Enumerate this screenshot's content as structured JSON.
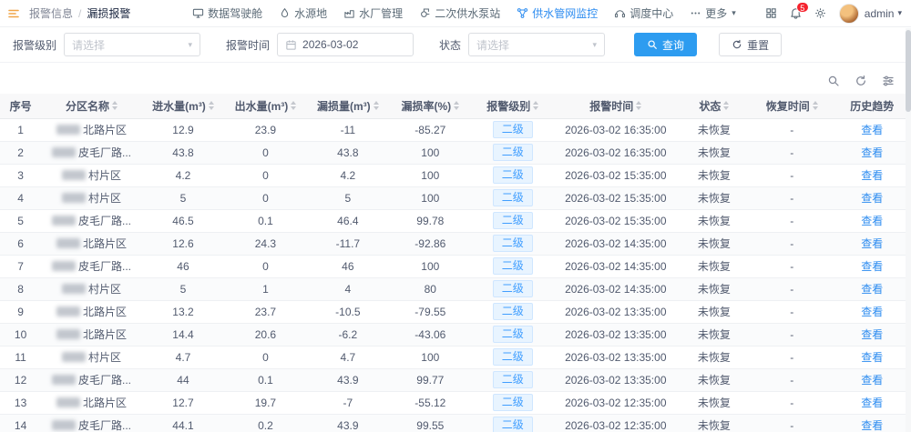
{
  "topbar": {
    "breadcrumb": {
      "parent": "报警信息",
      "separator": "/",
      "current": "漏损报警"
    },
    "nav": [
      {
        "label": "数据驾驶舱",
        "icon": "dashboard",
        "active": false
      },
      {
        "label": "水源地",
        "icon": "water-source",
        "active": false
      },
      {
        "label": "水厂管理",
        "icon": "water-plant",
        "active": false
      },
      {
        "label": "二次供水泵站",
        "icon": "pump-station",
        "active": false
      },
      {
        "label": "供水管网监控",
        "icon": "pipe-network",
        "active": true
      },
      {
        "label": "调度中心",
        "icon": "dispatch-center",
        "active": false
      },
      {
        "label": "更多",
        "icon": "more",
        "active": false,
        "caret": true
      }
    ],
    "badge_count": "5",
    "username": "admin"
  },
  "filters": {
    "level_label": "报警级别",
    "level_placeholder": "请选择",
    "time_label": "报警时间",
    "time_value": "2026-03-02",
    "status_label": "状态",
    "status_placeholder": "请选择",
    "search_label": "查询",
    "reset_label": "重置"
  },
  "table": {
    "headers": [
      "序号",
      "分区名称",
      "进水量(m³)",
      "出水量(m³)",
      "漏损量(m³)",
      "漏损率(%)",
      "报警级别",
      "报警时间",
      "状态",
      "恢复时间",
      "历史趋势"
    ],
    "rows": [
      {
        "index": "1",
        "zone": "北路片区",
        "in": "12.9",
        "out": "23.9",
        "loss": "-11",
        "rate": "-85.27",
        "level": "二级",
        "time": "2026-03-02 16:35:00",
        "status": "未恢复",
        "recover": "-",
        "action": "查看"
      },
      {
        "index": "2",
        "zone": "皮毛厂路...",
        "in": "43.8",
        "out": "0",
        "loss": "43.8",
        "rate": "100",
        "level": "二级",
        "time": "2026-03-02 16:35:00",
        "status": "未恢复",
        "recover": "-",
        "action": "查看"
      },
      {
        "index": "3",
        "zone": "村片区",
        "in": "4.2",
        "out": "0",
        "loss": "4.2",
        "rate": "100",
        "level": "二级",
        "time": "2026-03-02 15:35:00",
        "status": "未恢复",
        "recover": "-",
        "action": "查看"
      },
      {
        "index": "4",
        "zone": "村片区",
        "in": "5",
        "out": "0",
        "loss": "5",
        "rate": "100",
        "level": "二级",
        "time": "2026-03-02 15:35:00",
        "status": "未恢复",
        "recover": "-",
        "action": "查看"
      },
      {
        "index": "5",
        "zone": "皮毛厂路...",
        "in": "46.5",
        "out": "0.1",
        "loss": "46.4",
        "rate": "99.78",
        "level": "二级",
        "time": "2026-03-02 15:35:00",
        "status": "未恢复",
        "recover": "-",
        "action": "查看"
      },
      {
        "index": "6",
        "zone": "北路片区",
        "in": "12.6",
        "out": "24.3",
        "loss": "-11.7",
        "rate": "-92.86",
        "level": "二级",
        "time": "2026-03-02 14:35:00",
        "status": "未恢复",
        "recover": "-",
        "action": "查看"
      },
      {
        "index": "7",
        "zone": "皮毛厂路...",
        "in": "46",
        "out": "0",
        "loss": "46",
        "rate": "100",
        "level": "二级",
        "time": "2026-03-02 14:35:00",
        "status": "未恢复",
        "recover": "-",
        "action": "查看"
      },
      {
        "index": "8",
        "zone": "村片区",
        "in": "5",
        "out": "1",
        "loss": "4",
        "rate": "80",
        "level": "二级",
        "time": "2026-03-02 14:35:00",
        "status": "未恢复",
        "recover": "-",
        "action": "查看"
      },
      {
        "index": "9",
        "zone": "北路片区",
        "in": "13.2",
        "out": "23.7",
        "loss": "-10.5",
        "rate": "-79.55",
        "level": "二级",
        "time": "2026-03-02 13:35:00",
        "status": "未恢复",
        "recover": "-",
        "action": "查看"
      },
      {
        "index": "10",
        "zone": "北路片区",
        "in": "14.4",
        "out": "20.6",
        "loss": "-6.2",
        "rate": "-43.06",
        "level": "二级",
        "time": "2026-03-02 13:35:00",
        "status": "未恢复",
        "recover": "-",
        "action": "查看"
      },
      {
        "index": "11",
        "zone": "村片区",
        "in": "4.7",
        "out": "0",
        "loss": "4.7",
        "rate": "100",
        "level": "二级",
        "time": "2026-03-02 13:35:00",
        "status": "未恢复",
        "recover": "-",
        "action": "查看"
      },
      {
        "index": "12",
        "zone": "皮毛厂路...",
        "in": "44",
        "out": "0.1",
        "loss": "43.9",
        "rate": "99.77",
        "level": "二级",
        "time": "2026-03-02 13:35:00",
        "status": "未恢复",
        "recover": "-",
        "action": "查看"
      },
      {
        "index": "13",
        "zone": "北路片区",
        "in": "12.7",
        "out": "19.7",
        "loss": "-7",
        "rate": "-55.12",
        "level": "二级",
        "time": "2026-03-02 12:35:00",
        "status": "未恢复",
        "recover": "-",
        "action": "查看"
      },
      {
        "index": "14",
        "zone": "皮毛厂路...",
        "in": "44.1",
        "out": "0.2",
        "loss": "43.9",
        "rate": "99.55",
        "level": "二级",
        "time": "2026-03-02 12:35:00",
        "status": "未恢复",
        "recover": "-",
        "action": "查看"
      }
    ]
  },
  "colors": {
    "accent": "#2d8cf0",
    "primary_button": "#2d9cf0",
    "tag_bg": "#e8f4ff",
    "tag_text": "#409eff",
    "badge": "#f5222d"
  }
}
